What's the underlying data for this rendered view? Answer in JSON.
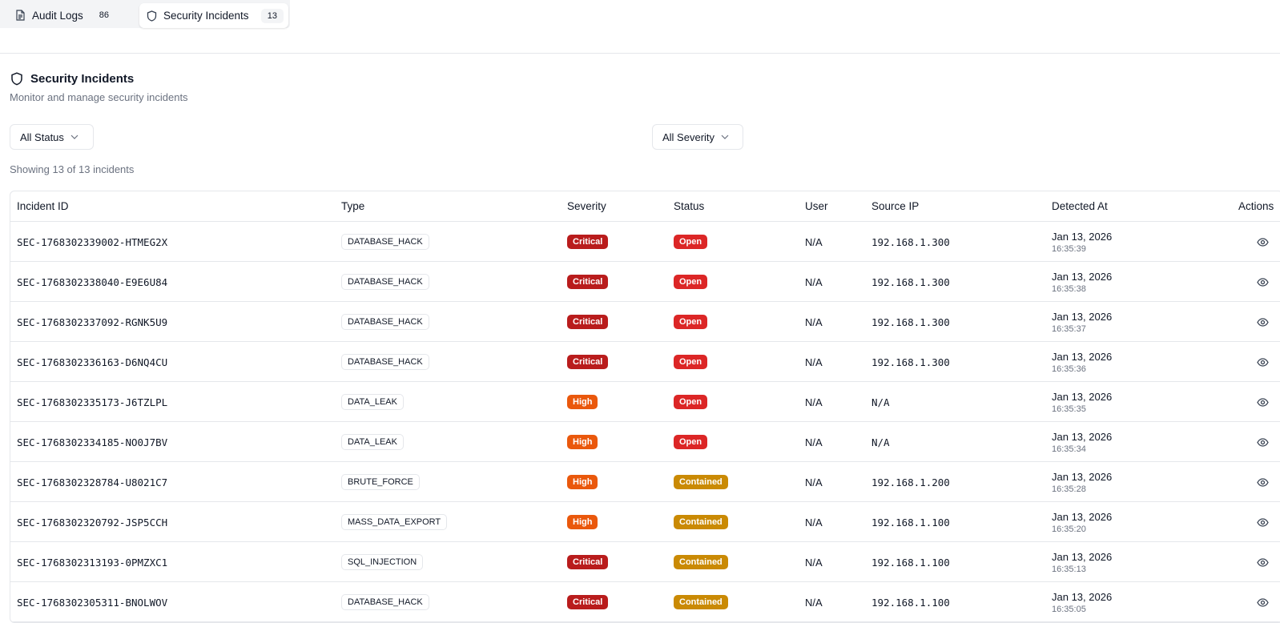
{
  "tabs": [
    {
      "label": "Audit Logs",
      "count": "86",
      "icon": "file-text-icon"
    },
    {
      "label": "Security Incidents",
      "count": "13",
      "icon": "shield-icon"
    }
  ],
  "section": {
    "title": "Security Incidents",
    "subtitle": "Monitor and manage security incidents",
    "icon": "shield-icon"
  },
  "filters": {
    "status": "All Status",
    "severity": "All Severity"
  },
  "showing": "Showing 13 of 13 incidents",
  "table": {
    "headers": {
      "id": "Incident ID",
      "type": "Type",
      "severity": "Severity",
      "status": "Status",
      "user": "User",
      "ip": "Source IP",
      "detected": "Detected At",
      "actions": "Actions"
    },
    "rows": [
      {
        "id": "SEC-1768302339002-HTMEG2X",
        "type": "DATABASE_HACK",
        "severity": "Critical",
        "status": "Open",
        "user": "N/A",
        "ip": "192.168.1.300",
        "date": "Jan 13, 2026",
        "time": "16:35:39"
      },
      {
        "id": "SEC-1768302338040-E9E6U84",
        "type": "DATABASE_HACK",
        "severity": "Critical",
        "status": "Open",
        "user": "N/A",
        "ip": "192.168.1.300",
        "date": "Jan 13, 2026",
        "time": "16:35:38"
      },
      {
        "id": "SEC-1768302337092-RGNK5U9",
        "type": "DATABASE_HACK",
        "severity": "Critical",
        "status": "Open",
        "user": "N/A",
        "ip": "192.168.1.300",
        "date": "Jan 13, 2026",
        "time": "16:35:37"
      },
      {
        "id": "SEC-1768302336163-D6NQ4CU",
        "type": "DATABASE_HACK",
        "severity": "Critical",
        "status": "Open",
        "user": "N/A",
        "ip": "192.168.1.300",
        "date": "Jan 13, 2026",
        "time": "16:35:36"
      },
      {
        "id": "SEC-1768302335173-J6TZLPL",
        "type": "DATA_LEAK",
        "severity": "High",
        "status": "Open",
        "user": "N/A",
        "ip": "N/A",
        "date": "Jan 13, 2026",
        "time": "16:35:35"
      },
      {
        "id": "SEC-1768302334185-NO0J7BV",
        "type": "DATA_LEAK",
        "severity": "High",
        "status": "Open",
        "user": "N/A",
        "ip": "N/A",
        "date": "Jan 13, 2026",
        "time": "16:35:34"
      },
      {
        "id": "SEC-1768302328784-U8021C7",
        "type": "BRUTE_FORCE",
        "severity": "High",
        "status": "Contained",
        "user": "N/A",
        "ip": "192.168.1.200",
        "date": "Jan 13, 2026",
        "time": "16:35:28"
      },
      {
        "id": "SEC-1768302320792-JSP5CCH",
        "type": "MASS_DATA_EXPORT",
        "severity": "High",
        "status": "Contained",
        "user": "N/A",
        "ip": "192.168.1.100",
        "date": "Jan 13, 2026",
        "time": "16:35:20"
      },
      {
        "id": "SEC-1768302313193-0PMZXC1",
        "type": "SQL_INJECTION",
        "severity": "Critical",
        "status": "Contained",
        "user": "N/A",
        "ip": "192.168.1.100",
        "date": "Jan 13, 2026",
        "time": "16:35:13"
      },
      {
        "id": "SEC-1768302305311-BNOLWOV",
        "type": "DATABASE_HACK",
        "severity": "Critical",
        "status": "Contained",
        "user": "N/A",
        "ip": "192.168.1.100",
        "date": "Jan 13, 2026",
        "time": "16:35:05"
      }
    ],
    "row_action_icon": "eye-icon"
  },
  "colors": {
    "critical": "#b91c1c",
    "high": "#ea580c",
    "open": "#dc2626",
    "contained": "#ca8a04"
  }
}
